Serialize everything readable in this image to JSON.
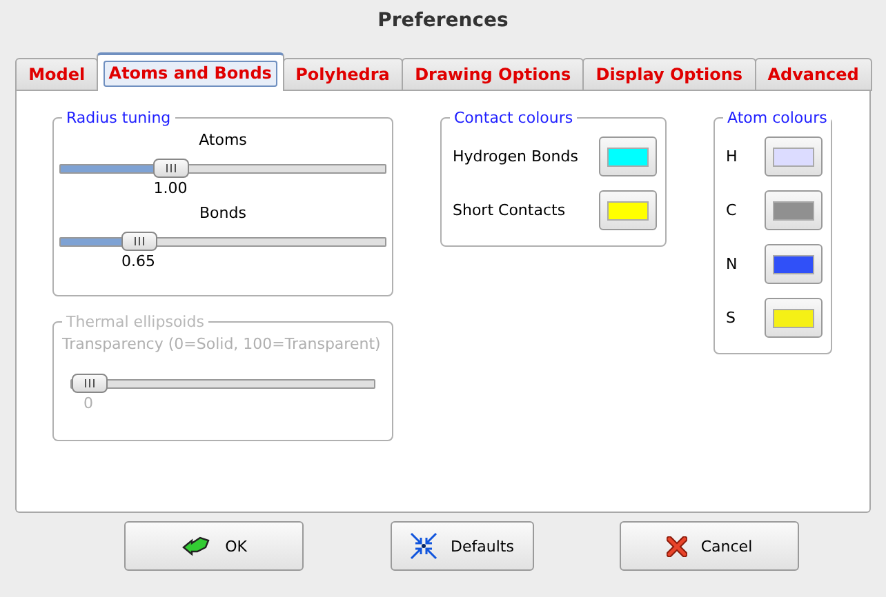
{
  "window": {
    "title": "Preferences"
  },
  "tabs": [
    {
      "label": "Model",
      "selected": false
    },
    {
      "label": "Atoms and Bonds",
      "selected": true
    },
    {
      "label": "Polyhedra",
      "selected": false
    },
    {
      "label": "Drawing Options",
      "selected": false
    },
    {
      "label": "Display Options",
      "selected": false
    },
    {
      "label": "Advanced",
      "selected": false
    }
  ],
  "radius_tuning": {
    "title": "Radius tuning",
    "sliders": [
      {
        "label": "Atoms",
        "level": 0.32,
        "reading": "1.00"
      },
      {
        "label": "Bonds",
        "level": 0.21,
        "reading": "0.65"
      }
    ]
  },
  "thermal_ellipsoids": {
    "title": "Thermal ellipsoids",
    "disabled": true,
    "label": "Transparency (0=Solid, 100=Transparent)",
    "slider": {
      "level": 0,
      "reading": "0"
    }
  },
  "contact_colours": {
    "title": "Contact colours",
    "items": [
      {
        "label": "Hydrogen Bonds",
        "color": "#00ffff"
      },
      {
        "label": "Short Contacts",
        "color": "#ffff00"
      }
    ]
  },
  "atom_colours": {
    "title": "Atom colours",
    "items": [
      {
        "label": "H",
        "color": "#dcdcff"
      },
      {
        "label": "C",
        "color": "#909090"
      },
      {
        "label": "N",
        "color": "#3050f8"
      },
      {
        "label": "S",
        "color": "#f5f016"
      }
    ]
  },
  "buttons": [
    {
      "label": "OK",
      "kind": "ok"
    },
    {
      "label": "Defaults",
      "kind": "defaults"
    },
    {
      "label": "Cancel",
      "kind": "cancel"
    }
  ]
}
